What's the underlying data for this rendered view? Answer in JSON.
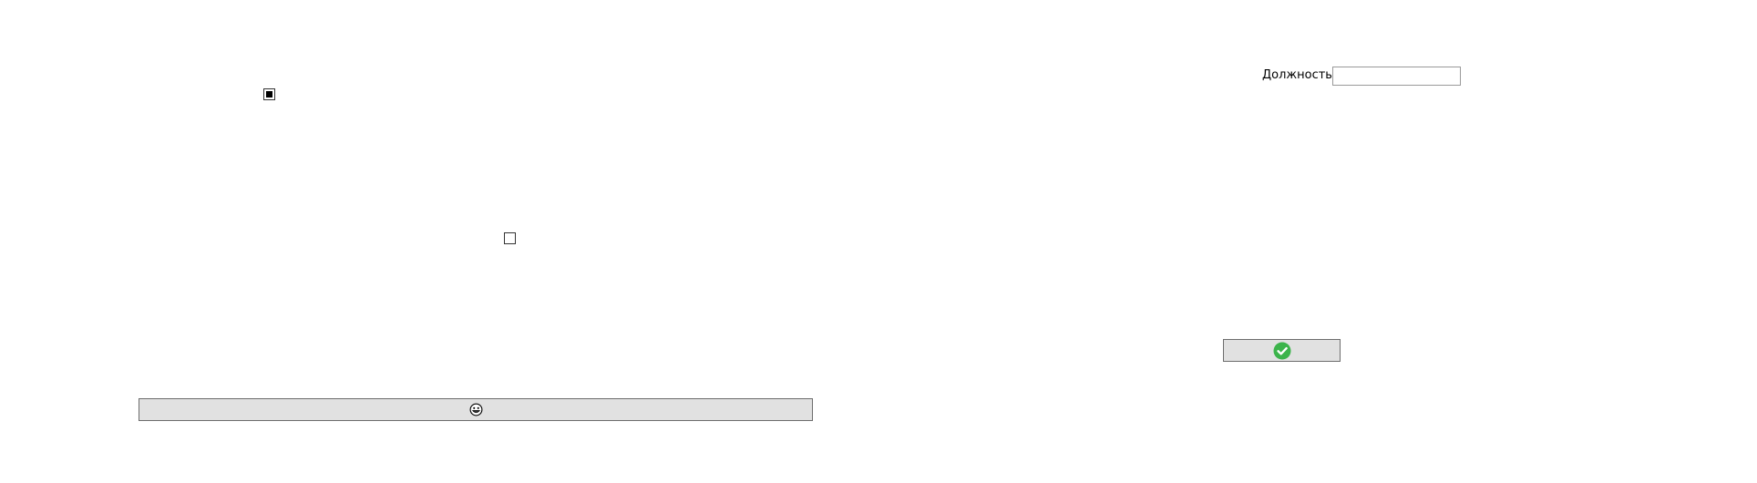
{
  "window": {
    "title": ""
  },
  "checkboxes": [
    {
      "name": "option-checkbox-1",
      "state": "indeterminate"
    },
    {
      "name": "option-checkbox-2",
      "state": "unchecked"
    }
  ],
  "position_field": {
    "label": "Должность",
    "value": "",
    "placeholder": ""
  },
  "buttons": {
    "wide_button": {
      "icon": "smiley-face-icon",
      "label": ""
    },
    "confirm_button": {
      "icon": "green-checkmark-icon",
      "label": "",
      "icon_color": "#3cb44b"
    }
  },
  "colors": {
    "button_background": "#e1e1e1",
    "button_border": "#6d6d6d",
    "input_border": "#999999",
    "check_green": "#3cb44b"
  }
}
